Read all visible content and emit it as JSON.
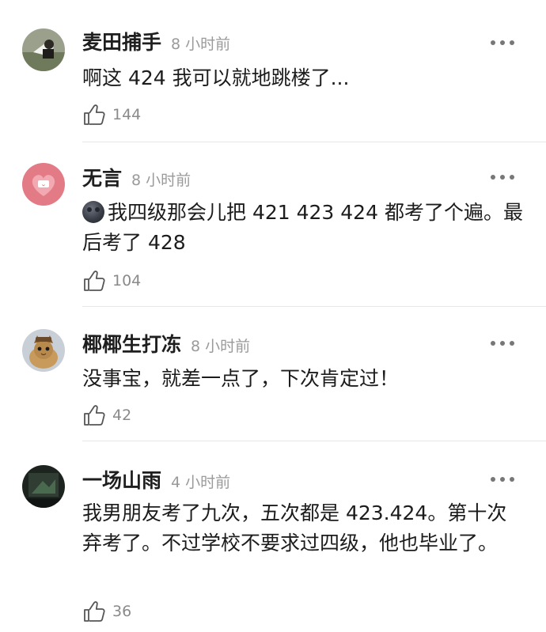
{
  "comments": [
    {
      "username": "麦田捕手",
      "time": "8 小时前",
      "avatar_icon": "photo-avatar",
      "text": "啊这 424 我可以就地跳楼了...",
      "likes": "144"
    },
    {
      "username": "无言",
      "time": "8 小时前",
      "avatar_icon": "pink-heart-avatar",
      "emoji": "new-moon-face-emoji",
      "text": "我四级那会儿把 421 423 424 都考了个遍。最后考了 428",
      "likes": "104"
    },
    {
      "username": "椰椰生打冻",
      "time": "8 小时前",
      "avatar_icon": "cat-avatar",
      "text": "没事宝，就差一点了，下次肯定过！",
      "likes": "42"
    },
    {
      "username": "一场山雨",
      "time": "4 小时前",
      "avatar_icon": "dark-photo-avatar",
      "text": "我男朋友考了九次，五次都是 423.424。第十次弃考了。不过学校不要求过四级，他也毕业了。",
      "likes": "36"
    }
  ],
  "icons": {
    "like": "thumbs-up-icon",
    "more": "more-dots-icon"
  },
  "colors": {
    "name": "#1f1f1f",
    "meta": "#9a9a9a",
    "divider": "#e6e6e6"
  }
}
